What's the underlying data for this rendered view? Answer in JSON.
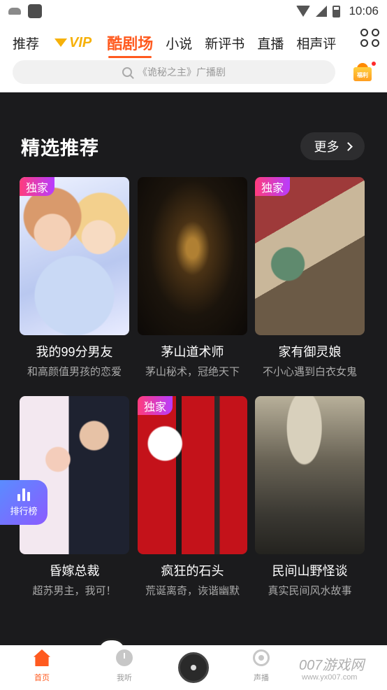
{
  "status_bar": {
    "time": "10:06"
  },
  "header": {
    "tabs": [
      {
        "label": "推荐"
      },
      {
        "label": "VIP"
      },
      {
        "label": "酷剧场"
      },
      {
        "label": "小说"
      },
      {
        "label": "新评书"
      },
      {
        "label": "直播"
      },
      {
        "label": "相声评"
      }
    ],
    "active_tab": "酷剧场",
    "search": {
      "placeholder": "《诡秘之主》广播剧"
    },
    "gift_label": "福利"
  },
  "section": {
    "title": "精选推荐",
    "more_label": "更多"
  },
  "cards": [
    {
      "title": "我的99分男友",
      "subtitle": "和高颜值男孩的恋爱",
      "badge": "独家"
    },
    {
      "title": "茅山道术师",
      "subtitle": "茅山秘术，冠绝天下",
      "badge": ""
    },
    {
      "title": "家有御灵娘",
      "subtitle": "不小心遇到白衣女鬼",
      "badge": "独家"
    },
    {
      "title": "昏嫁总裁",
      "subtitle": "超苏男主，我可！",
      "badge": ""
    },
    {
      "title": "疯狂的石头",
      "subtitle": "荒诞离奇，诙谐幽默",
      "badge": "独家"
    },
    {
      "title": "民间山野怪谈",
      "subtitle": "真实民间风水故事",
      "badge": ""
    }
  ],
  "ranking_tab": {
    "label": "排行榜"
  },
  "bottom_nav": {
    "items": [
      {
        "label": "首页"
      },
      {
        "label": "我听"
      },
      {
        "label": "声播"
      }
    ]
  },
  "watermark": {
    "text": "007游戏网",
    "sub": "www.yx007.com"
  },
  "colors": {
    "accent": "#ff5a1f",
    "vip": "#f6b10a",
    "background": "#1b1b1d"
  }
}
